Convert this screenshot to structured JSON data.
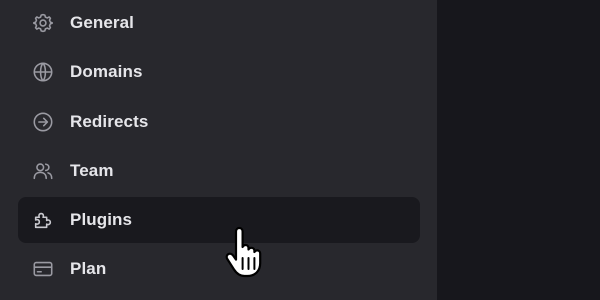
{
  "sidebar": {
    "items": [
      {
        "label": "General",
        "icon": "gear-icon",
        "active": false
      },
      {
        "label": "Domains",
        "icon": "globe-icon",
        "active": false
      },
      {
        "label": "Redirects",
        "icon": "arrow-right-circle-icon",
        "active": false
      },
      {
        "label": "Team",
        "icon": "users-icon",
        "active": false
      },
      {
        "label": "Plugins",
        "icon": "puzzle-icon",
        "active": true
      },
      {
        "label": "Plan",
        "icon": "credit-card-icon",
        "active": false
      }
    ]
  },
  "colors": {
    "sidebar_bg": "#28282d",
    "active_item_bg": "#19191e",
    "main_bg": "#17171c",
    "label_text": "#e6e6ea",
    "icon_stroke": "#9a9aa2"
  }
}
